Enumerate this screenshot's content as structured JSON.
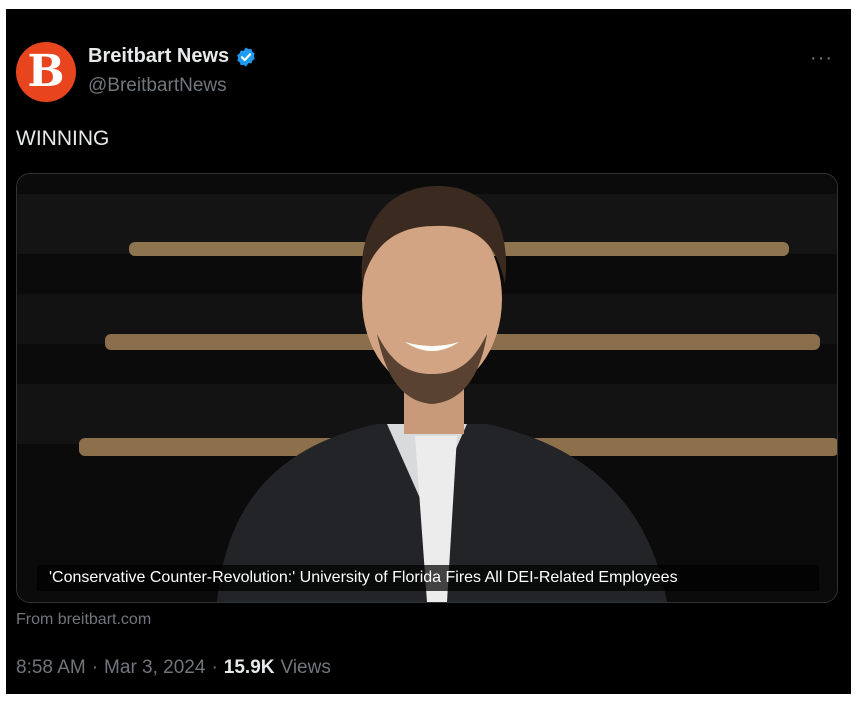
{
  "author": {
    "display_name": "Breitbart News",
    "handle": "@BreitbartNews",
    "avatar_letter": "B",
    "verified": true
  },
  "more_label": "···",
  "tweet_text": "WINNING",
  "card": {
    "headline": "'Conservative Counter-Revolution:' University of Florida Fires All DEI-Related Employees",
    "source": "From breitbart.com"
  },
  "meta": {
    "time": "8:58 AM",
    "separator": "·",
    "date": "Mar 3, 2024",
    "views_count": "15.9K",
    "views_label": "Views"
  },
  "colors": {
    "background": "#000000",
    "brand": "#e8451f",
    "verified_blue": "#1d9bf0",
    "primary_text": "#e7e9ea",
    "secondary_text": "#71767b"
  }
}
